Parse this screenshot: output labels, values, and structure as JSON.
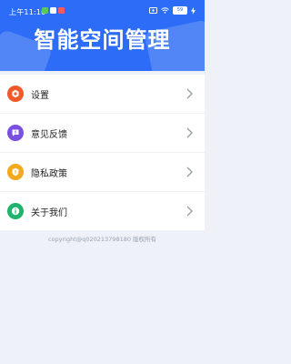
{
  "status_bar": {
    "time": "上午11:10",
    "battery": "59"
  },
  "header": {
    "title": "智能空间管理"
  },
  "menu": {
    "items": [
      {
        "label": "设置",
        "icon": "settings-icon",
        "color": "#f05a2b"
      },
      {
        "label": "意见反馈",
        "icon": "feedback-icon",
        "color": "#7b4fe0"
      },
      {
        "label": "隐私政策",
        "icon": "privacy-shield-icon",
        "color": "#f4a81b"
      },
      {
        "label": "关于我们",
        "icon": "info-icon",
        "color": "#1fb36b"
      }
    ]
  },
  "footer": {
    "copyright": "copyright@q020213798180 版权所有"
  },
  "colors": {
    "header_bg": "#2d6cf6",
    "page_bg": "#eef1f7"
  }
}
